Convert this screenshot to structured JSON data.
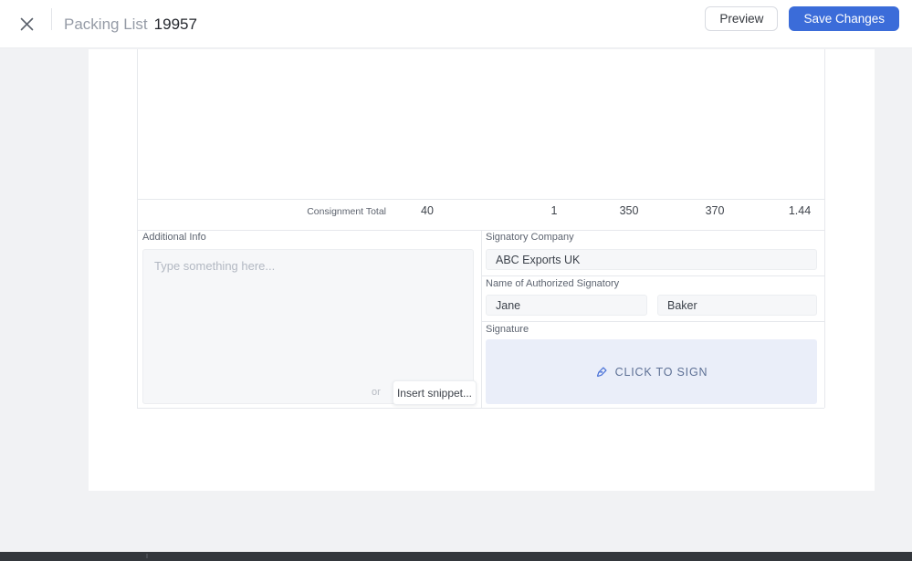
{
  "header": {
    "doc_type": "Packing List",
    "doc_number": "19957",
    "preview_label": "Preview",
    "save_label": "Save Changes"
  },
  "totals": {
    "label": "Consignment Total",
    "values": [
      "40",
      "1",
      "350",
      "370",
      "1.44"
    ]
  },
  "additional_info": {
    "label": "Additional Info",
    "placeholder": "Type something here...",
    "or_label": "or",
    "insert_snippet_label": "Insert snippet..."
  },
  "signatory": {
    "company_label": "Signatory Company",
    "company_value": "ABC Exports UK",
    "name_label": "Name of Authorized Signatory",
    "first_name": "Jane",
    "last_name": "Baker",
    "signature_label": "Signature",
    "click_to_sign_label": "CLICK TO SIGN"
  },
  "icons": {
    "close": "close-icon",
    "pen_nib": "pen-nib-icon"
  },
  "colors": {
    "accent_blue": "#3b6cd9",
    "sign_box_bg": "#eaeef9",
    "sign_text": "#5d7095",
    "taskbar": "#34373c"
  }
}
